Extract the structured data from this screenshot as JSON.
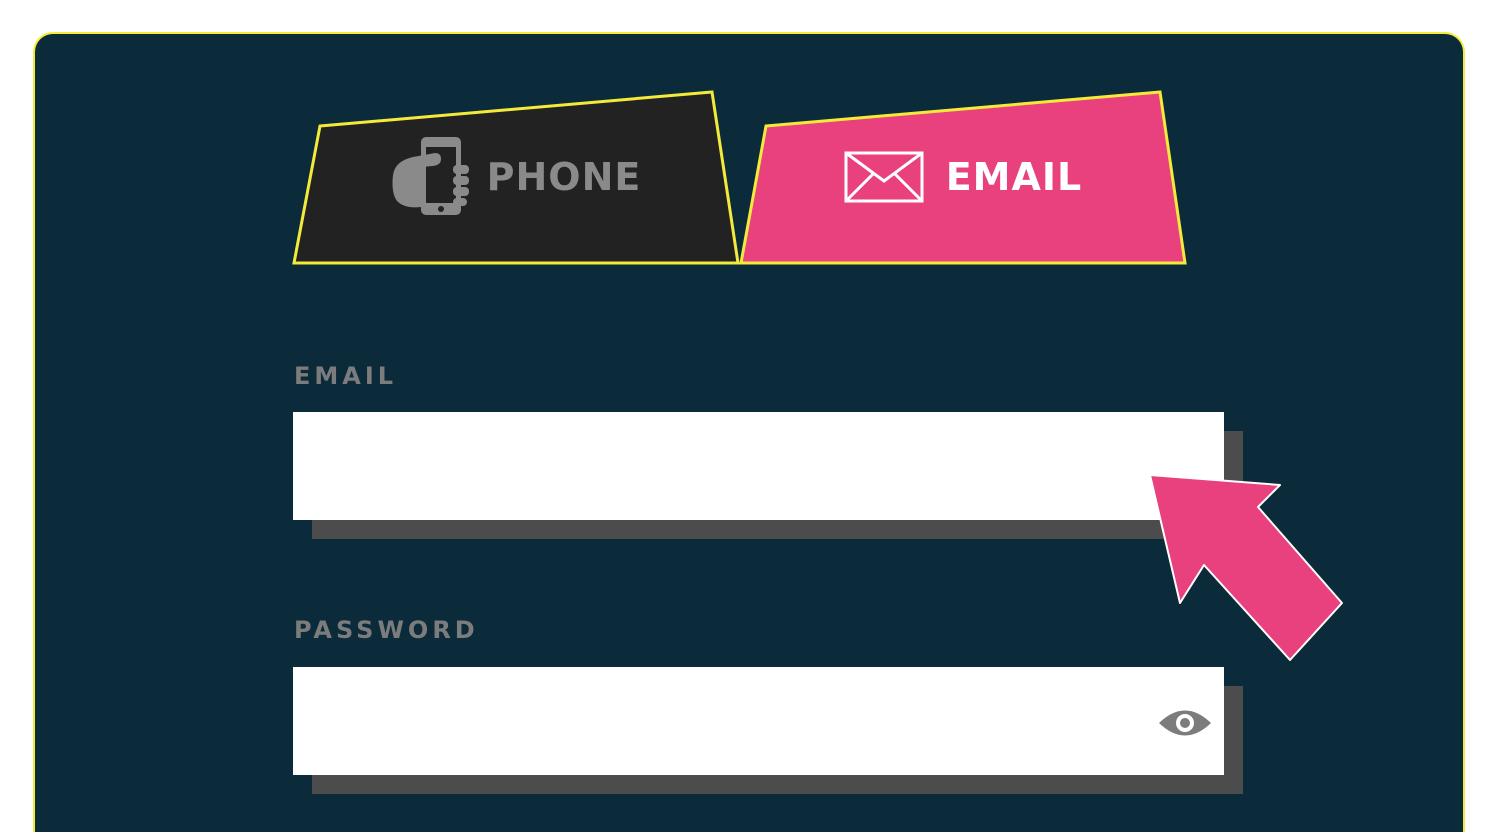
{
  "tabs": {
    "phone": {
      "label": "PHONE",
      "icon": "phone-in-hand-icon",
      "selected": false
    },
    "email": {
      "label": "EMAIL",
      "icon": "envelope-icon",
      "selected": true
    }
  },
  "form": {
    "email": {
      "label": "EMAIL",
      "value": "",
      "placeholder": ""
    },
    "password": {
      "label": "PASSWORD",
      "value": "",
      "placeholder": "",
      "toggle_icon": "eye-icon"
    }
  },
  "pointer": {
    "icon": "pointer-arrow-icon"
  },
  "colors": {
    "background": "#0b2a3a",
    "accent": "#e8417e",
    "outline": "#f4ea3a",
    "tab_inactive": "#222222",
    "muted_text": "#7c7c7c"
  }
}
